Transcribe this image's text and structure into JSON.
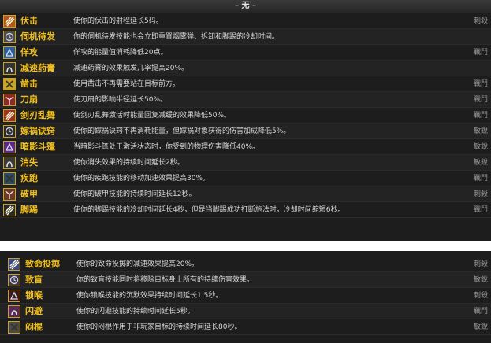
{
  "section1": {
    "header": "– 无 –",
    "rows": [
      {
        "name": "伏击",
        "desc": "使你的伏击的射程延长5码。",
        "spec": "刺殺",
        "icon": "ambush-icon",
        "color": "#b8561e"
      },
      {
        "name": "伺机待发",
        "desc": "你的伺机待发技能也会立即重置烟雾弹、拆卸和脚踢的冷却时间。",
        "spec": "",
        "icon": "preparation-icon",
        "color": "#4a4a52"
      },
      {
        "name": "佯攻",
        "desc": "佯攻的能量值消耗降低20点。",
        "spec": "戰鬥",
        "icon": "feint-icon",
        "color": "#2c5fa0"
      },
      {
        "name": "减速药膏",
        "desc": "减速药膏的效果触发几率提高20%。",
        "spec": "",
        "icon": "crippling-poison-icon",
        "color": "#333333"
      },
      {
        "name": "凿击",
        "desc": "使用凿击不再需要站在目标前方。",
        "spec": "戰鬥",
        "icon": "gouge-icon",
        "color": "#c9a227"
      },
      {
        "name": "刀扇",
        "desc": "使刀扇的影响半径延长50%。",
        "spec": "戰鬥",
        "icon": "fan-of-knives-icon",
        "color": "#8a2a2a"
      },
      {
        "name": "剑刃乱舞",
        "desc": "使剑刃乱舞激活时能量回复减缓的效果降低50%。",
        "spec": "戰鬥",
        "icon": "blade-flurry-icon",
        "color": "#a03020"
      },
      {
        "name": "嫁祸诀窍",
        "desc": "使你的嫁祸诀窍不再消耗能量，但嫁祸对象获得的伤害加成降低5%。",
        "spec": "敏銳",
        "icon": "tricks-of-the-trade-icon",
        "color": "#2a2a2a"
      },
      {
        "name": "暗影斗篷",
        "desc": "当暗影斗篷处于激活状态时，你受到的物理伤害降低40%。",
        "spec": "敏銳",
        "icon": "cloak-of-shadows-icon",
        "color": "#5a2a8a"
      },
      {
        "name": "消失",
        "desc": "使你消失效果的持续时间延长2秒。",
        "spec": "敏銳",
        "icon": "vanish-icon",
        "color": "#3a3a3a"
      },
      {
        "name": "疾跑",
        "desc": "使你的疾跑技能的移动加速效果提高30%。",
        "spec": "戰鬥",
        "icon": "sprint-icon",
        "color": "#2a4a6a"
      },
      {
        "name": "破甲",
        "desc": "使你的破甲技能的持续时间延长12秒。",
        "spec": "刺殺",
        "icon": "expose-armor-icon",
        "color": "#6a3a2a"
      },
      {
        "name": "脚踢",
        "desc": "使你的脚踢技能的冷却时间延长4秒，但是当脚踢成功打断施法时，冷却时间缩短6秒。",
        "spec": "戰鬥",
        "icon": "kick-icon",
        "color": "#2a2a2a"
      }
    ]
  },
  "section2": {
    "rows": [
      {
        "name": "致命投掷",
        "desc": "使你的致命投掷的减速效果提高20%。",
        "spec": "刺殺",
        "icon": "deadly-throw-icon",
        "color": "#3a4a8a"
      },
      {
        "name": "致盲",
        "desc": "你的致盲技能同时将移除目标身上所有的持续伤害效果。",
        "spec": "敏銳",
        "icon": "blind-icon",
        "color": "#3a3a4a"
      },
      {
        "name": "锁喉",
        "desc": "使你锁喉技能的沉默效果持续时间延长1.5秒。",
        "spec": "刺殺",
        "icon": "garrote-icon",
        "color": "#3a1a1a"
      },
      {
        "name": "闪避",
        "desc": "使你的闪避技能的持续时间延长5秒。",
        "spec": "戰鬥",
        "icon": "evasion-icon",
        "color": "#5a2a5a"
      },
      {
        "name": "闷棍",
        "desc": "使你的闷棍作用于非玩家目标的持续时间延长80秒。",
        "spec": "敏銳",
        "icon": "sap-icon",
        "color": "#4a4a4a"
      }
    ]
  }
}
